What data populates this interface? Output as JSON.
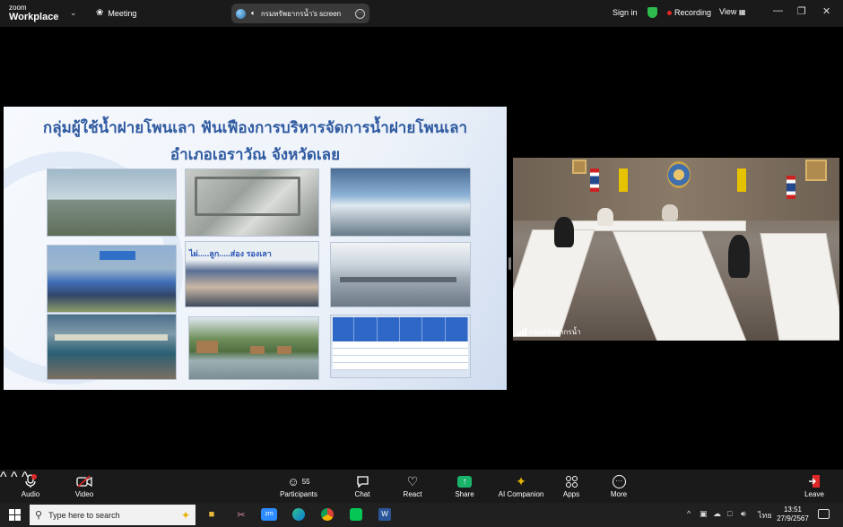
{
  "topbar": {
    "app_name_line1": "zoom",
    "app_name_line2": "Workplace",
    "meeting_label": "Meeting",
    "share_title": "กรมทรัพยากรน้ำ's screen",
    "signin": "Sign in",
    "recording": "Recording",
    "view": "View",
    "colors": {
      "recording_dot": "#e02828",
      "shield": "#2dbb4d"
    }
  },
  "slide": {
    "title_line1": "กลุ่มผู้ใช้น้ำฝายโพนเลา ฟันเฟืองการบริหารจัดการน้ำฝายโพนเลา",
    "title_line2": "อำเภอเอราวัณ จังหวัดเลย",
    "banner_text": "ไผ่.....ลูก.....ส่อง รองเลา",
    "photos": [
      "weir-concrete",
      "weir-structure",
      "reservoir",
      "group-photo",
      "ceremony",
      "dock",
      "river-boats",
      "floating-huts",
      "data-table"
    ],
    "title_color": "#2f5aa0"
  },
  "camera": {
    "participant_name": "กรมทรัพยากรน้ำ"
  },
  "toolbar": {
    "audio": "Audio",
    "video": "Video",
    "participants": "Participants",
    "participants_count": "55",
    "chat": "Chat",
    "react": "React",
    "share": "Share",
    "ai_companion": "AI Companion",
    "apps": "Apps",
    "more": "More",
    "leave": "Leave",
    "colors": {
      "share": "#1ab36a",
      "leave": "#e02828",
      "muted": "#e02828"
    }
  },
  "taskbar": {
    "search_placeholder": "Type here to search",
    "language": "ไทย",
    "time": "13:51",
    "date": "27/9/2567"
  }
}
